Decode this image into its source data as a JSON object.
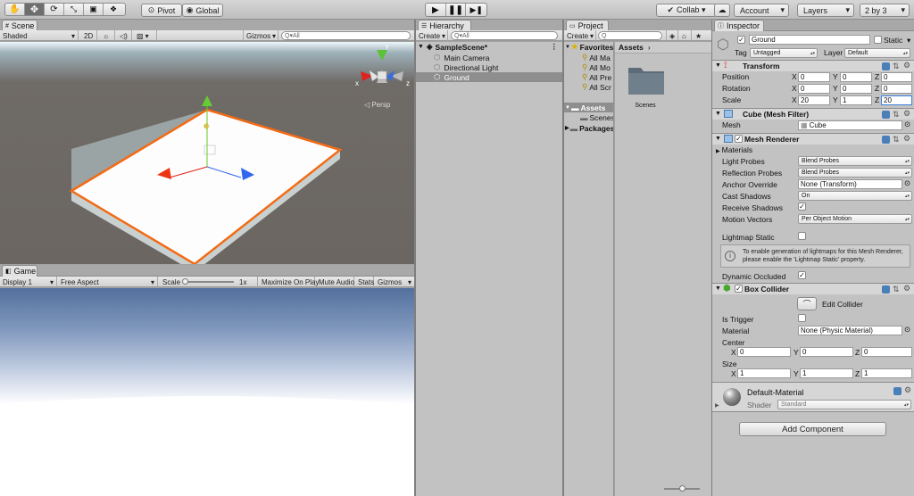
{
  "toolbar": {
    "tools": [
      "hand-tool",
      "move-tool",
      "rotate-tool",
      "scale-tool",
      "rect-tool",
      "transform-tool"
    ],
    "pivot_label": "Pivot",
    "global_label": "Global",
    "collab_label": "Collab ▾",
    "account_label": "Account",
    "layers_label": "Layers",
    "layout_label": "2 by 3"
  },
  "scene": {
    "tab_label": "Scene",
    "shaded": "Shaded",
    "mode_2d": "2D",
    "gizmos": "Gizmos",
    "search_placeholder": "Q▾All",
    "persp_label": "◁ Persp",
    "gizmo_x": "x",
    "gizmo_z": "z",
    "gizmo_y": "y"
  },
  "game": {
    "tab_label": "Game",
    "display": "Display 1",
    "aspect": "Free Aspect",
    "scale_label": "Scale",
    "scale_value": "1x",
    "maximize": "Maximize On Play",
    "mute": "Mute Audio",
    "stats": "Stats",
    "gizmos": "Gizmos"
  },
  "hierarchy": {
    "tab_label": "Hierarchy",
    "create": "Create",
    "search_placeholder": "Q▾All",
    "scene_name": "SampleScene*",
    "items": [
      "Main Camera",
      "Directional Light",
      "Ground"
    ]
  },
  "project": {
    "tab_label": "Project",
    "create": "Create",
    "favorites": "Favorites",
    "favorite_items": [
      "All Ma",
      "All Mo",
      "All Pre",
      "All Scr"
    ],
    "assets": "Assets",
    "scenes": "Scenes",
    "packages": "Packages",
    "breadcrumb": "Assets",
    "folder_name": "Scenes"
  },
  "inspector": {
    "tab_label": "Inspector",
    "object_name": "Ground",
    "static_label": "Static",
    "tag_label": "Tag",
    "tag_value": "Untagged",
    "layer_label": "Layer",
    "layer_value": "Default",
    "transform": {
      "title": "Transform",
      "position_label": "Position",
      "rotation_label": "Rotation",
      "scale_label": "Scale",
      "position": {
        "x": "0",
        "y": "0",
        "z": "0"
      },
      "rotation": {
        "x": "0",
        "y": "0",
        "z": "0"
      },
      "scale": {
        "x": "20",
        "y": "1",
        "z": "20"
      }
    },
    "mesh_filter": {
      "title": "Cube (Mesh Filter)",
      "mesh_label": "Mesh",
      "mesh_value": "Cube"
    },
    "mesh_renderer": {
      "title": "Mesh Renderer",
      "materials": "Materials",
      "light_probes_label": "Light Probes",
      "light_probes_value": "Blend Probes",
      "reflection_probes_label": "Reflection Probes",
      "reflection_probes_value": "Blend Probes",
      "anchor_override_label": "Anchor Override",
      "anchor_override_value": "None (Transform)",
      "cast_shadows_label": "Cast Shadows",
      "cast_shadows_value": "On",
      "receive_shadows_label": "Receive Shadows",
      "motion_vectors_label": "Motion Vectors",
      "motion_vectors_value": "Per Object Motion",
      "lightmap_static_label": "Lightmap Static",
      "info_text": "To enable generation of lightmaps for this Mesh Renderer, please enable the 'Lightmap Static' property.",
      "dynamic_occluded_label": "Dynamic Occluded"
    },
    "box_collider": {
      "title": "Box Collider",
      "edit_collider": "Edit Collider",
      "is_trigger_label": "Is Trigger",
      "material_label": "Material",
      "material_value": "None (Physic Material)",
      "center_label": "Center",
      "size_label": "Size",
      "center": {
        "x": "0",
        "y": "0",
        "z": "0"
      },
      "size": {
        "x": "1",
        "y": "1",
        "z": "1"
      }
    },
    "material": {
      "name": "Default-Material",
      "shader_label": "Shader",
      "shader_value": "Standard"
    },
    "add_component": "Add Component",
    "axis_x": "X",
    "axis_y": "Y",
    "axis_z": "Z"
  },
  "colors": {
    "accent_orange": "#f26b16",
    "selection_blue": "#3d80df",
    "panel_gray": "#c2c2c2",
    "toolbar_gray": "#c9c9c9"
  }
}
